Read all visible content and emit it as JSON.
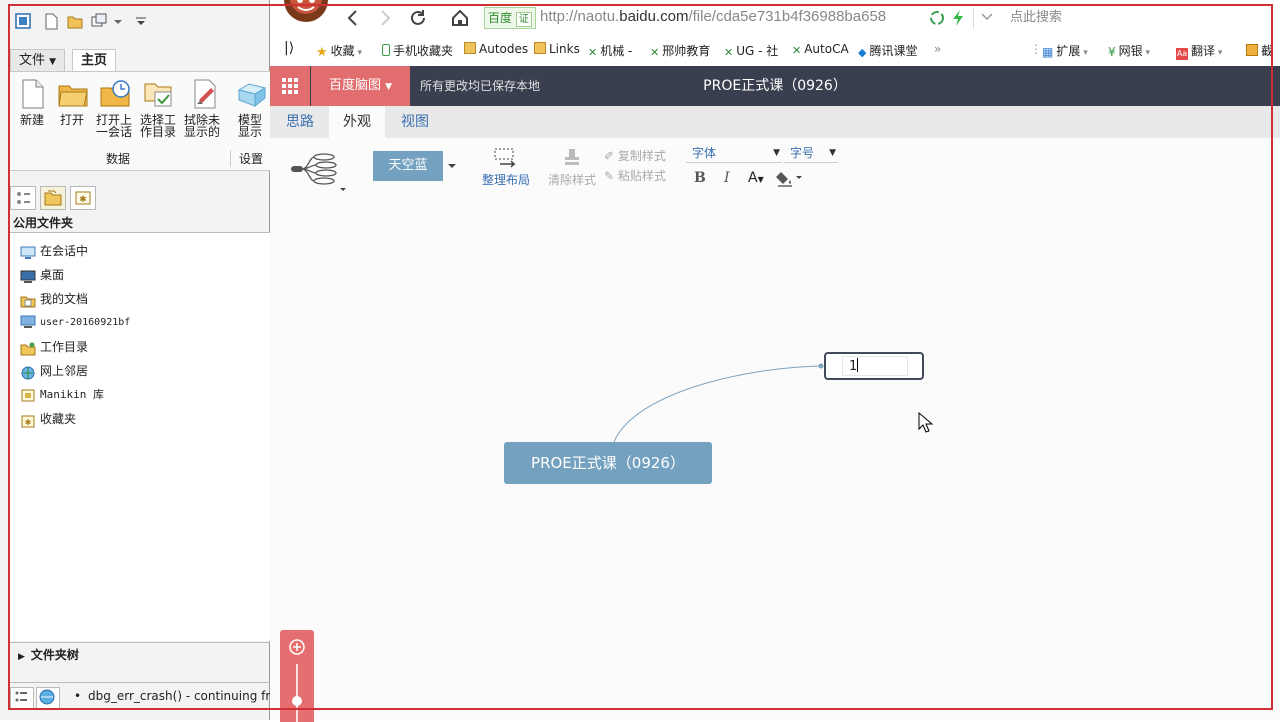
{
  "left_app": {
    "menu_tabs": [
      "文件",
      "主页"
    ],
    "ribbon_buttons": [
      {
        "label": "新建",
        "icon": "new-file-icon"
      },
      {
        "label": "打开",
        "icon": "open-folder-icon"
      },
      {
        "label": "打开上\n一会话",
        "icon": "open-session-icon"
      },
      {
        "label": "选择工\n作目录",
        "icon": "select-workdir-icon"
      },
      {
        "label": "拭除未\n显示的",
        "icon": "erase-icon"
      },
      {
        "label": "模型\n显示",
        "icon": "model-display-icon"
      }
    ],
    "groups": [
      "数据",
      "设置"
    ],
    "folder_header": "公用文件夹",
    "folders": [
      "在会话中",
      "桌面",
      "我的文档",
      "user-20160921bf",
      "工作目录",
      "网上邻居",
      "Manikin 库",
      "收藏夹"
    ],
    "folder_tree": "文件夹树",
    "status_message": "dbg_err_crash() - continuing from"
  },
  "browser": {
    "url_prefix": "http://naotu.",
    "url_domain": "baidu.com",
    "url_path": "/file/cda5e731b4f36988ba658",
    "baidu_badge": "百度",
    "cert_badge": "证",
    "search_placeholder": "点此搜索",
    "bookmarks": [
      "收藏",
      "手机收藏夹",
      "Autodes",
      "Links",
      "机械 -",
      "邢帅教育",
      "UG - 社",
      "AutoCA",
      "腾讯课堂"
    ],
    "right_bookmarks": [
      "扩展",
      "网银",
      "翻译",
      "截"
    ],
    "more": "»"
  },
  "naotu": {
    "brand": "百度脑图",
    "save_status": "所有更改均已保存本地",
    "doc_title": "PROE正式课（0926）",
    "tabs": [
      "思路",
      "外观",
      "视图"
    ],
    "active_tab": "外观",
    "theme": "天空蓝",
    "arrange_layout": "整理布局",
    "clear_style": "清除样式",
    "copy_style": "复制样式",
    "paste_style": "粘贴样式",
    "font_select": "字体",
    "size_select": "字号",
    "bold": "B",
    "italic": "I",
    "font_color": "A",
    "root_node": "PROE正式课（0926）",
    "child_node_value": "1",
    "colors": {
      "header_bg": "#393f4f",
      "brand_bg": "#e16d6f",
      "root_node": "#73a1bf",
      "frame": "#cf3036"
    }
  }
}
